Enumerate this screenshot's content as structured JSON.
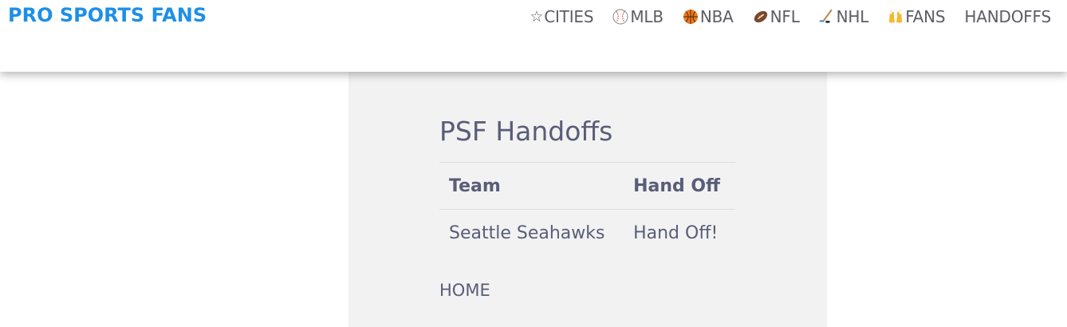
{
  "header": {
    "brand": "PRO SPORTS FANS",
    "nav": [
      {
        "label": "CITIES",
        "icon": "star-icon"
      },
      {
        "label": "MLB",
        "icon": "baseball-icon"
      },
      {
        "label": "NBA",
        "icon": "basketball-icon"
      },
      {
        "label": "NFL",
        "icon": "football-icon"
      },
      {
        "label": "NHL",
        "icon": "hockey-icon"
      },
      {
        "label": "FANS",
        "icon": "raised-hands-icon"
      },
      {
        "label": "HANDOFFS",
        "icon": ""
      }
    ]
  },
  "main": {
    "title": "PSF Handoffs",
    "table": {
      "headers": [
        "Team",
        "Hand Off"
      ],
      "rows": [
        {
          "team": "Seattle Seahawks",
          "handoff": "Hand Off!"
        }
      ]
    },
    "home_link": "HOME"
  },
  "colors": {
    "brand": "#1e8fe6",
    "text": "#595d78",
    "nav_text": "#5c5c66",
    "panel_bg": "#f2f2f2",
    "divider": "#dddddd"
  }
}
